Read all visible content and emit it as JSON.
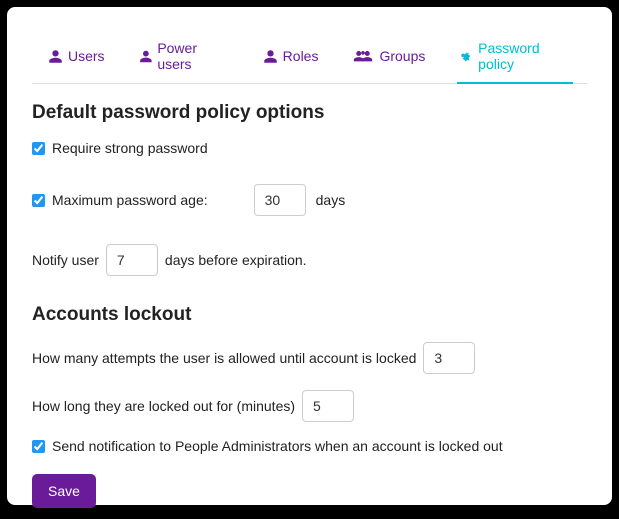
{
  "tabs": {
    "users": "Users",
    "power_users": "Power users",
    "roles": "Roles",
    "groups": "Groups",
    "password_policy": "Password policy"
  },
  "section1_title": "Default password policy options",
  "require_strong_label": "Require strong password",
  "require_strong_checked": true,
  "max_age_label": "Maximum password age:",
  "max_age_value": "30",
  "max_age_unit": "days",
  "max_age_checked": true,
  "notify_prefix": "Notify user",
  "notify_value": "7",
  "notify_suffix": "days before expiration.",
  "section2_title": "Accounts lockout",
  "attempts_label": "How many attempts the user is allowed until account is locked",
  "attempts_value": "3",
  "lockout_duration_label": "How long they are locked out for (minutes)",
  "lockout_duration_value": "5",
  "send_notification_label": "Send notification to People Administrators when an account is locked out",
  "send_notification_checked": true,
  "save_label": "Save"
}
